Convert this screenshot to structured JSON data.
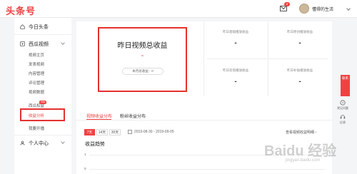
{
  "header": {
    "logo": "头条号",
    "mail_badge": "8",
    "username": "懂得的生活"
  },
  "sidebar": {
    "home": "今日头条",
    "video_group": "西瓜视频",
    "video_items": [
      "视频主页",
      "发表视频",
      "内容管理",
      "评论管理",
      "视频数据",
      "西瓜权益",
      "收益分析",
      "我要开播"
    ],
    "new_badge": "new",
    "personal": "个人中心"
  },
  "summary": {
    "main_title": "昨日视频总收益",
    "main_value": "-",
    "monthly_label": "本月总收益：0",
    "stats": [
      {
        "label": "昨日基础播放收益",
        "value": "-"
      },
      {
        "label": "昨日原创播放收益",
        "value": "-"
      },
      {
        "label": "昨日双倍播放收益",
        "value": "-"
      },
      {
        "label": "昨日补贴播放收益",
        "value": "-"
      }
    ]
  },
  "tabs": [
    "视频收益分布",
    "粉丝收益分布"
  ],
  "filters": {
    "ranges": [
      "7天",
      "14天",
      "30天"
    ],
    "date_range": "2019-08-30 - 2019-09-05",
    "detail_link": "查看视频收益明细"
  },
  "chart": {
    "title": "收益趋势",
    "y_ticks": [
      "1",
      "0"
    ]
  },
  "float": {
    "red_label": "联系",
    "help": "常见问题",
    "feedback": "反馈"
  },
  "watermark": {
    "brand": "Baidu 经验",
    "url": "jingyan.baidu.com"
  },
  "colors": {
    "accent": "#f04142",
    "highlight": "#e5312e"
  }
}
